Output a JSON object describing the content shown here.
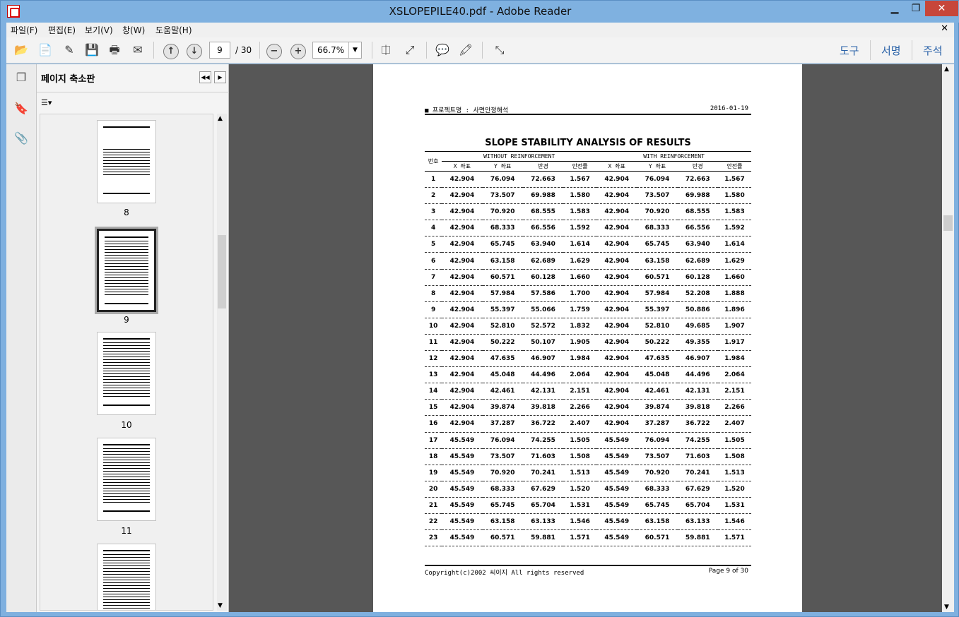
{
  "window": {
    "title": "XSLOPEPILE40.pdf - Adobe Reader",
    "min": "▁",
    "max": "❐",
    "close": "✕"
  },
  "menu": [
    "파일(F)",
    "편집(E)",
    "보기(V)",
    "창(W)",
    "도움말(H)"
  ],
  "menu_close": "✕",
  "toolbar": {
    "page_current": "9",
    "page_total": "/ 30",
    "zoom": "66.7%",
    "links": [
      "도구",
      "서명",
      "주석"
    ]
  },
  "panel": {
    "title": "페이지 축소판",
    "thumbs": [
      "8",
      "9",
      "10",
      "11"
    ]
  },
  "doc": {
    "header_left": "■ 프로젝트명 : 사면안정해석",
    "header_date": "2016-01-19",
    "title": "SLOPE STABILITY ANALYSIS OF RESULTS",
    "col_no": "번호",
    "group_without": "WITHOUT REINFORCEMENT",
    "group_with": "WITH REINFORCEMENT",
    "cols": [
      "X 좌표",
      "Y 좌표",
      "반경",
      "안전률",
      "X 좌표",
      "Y 좌표",
      "반경",
      "안전률"
    ],
    "rows": [
      [
        "1",
        "42.904",
        "76.094",
        "72.663",
        "1.567",
        "42.904",
        "76.094",
        "72.663",
        "1.567"
      ],
      [
        "2",
        "42.904",
        "73.507",
        "69.988",
        "1.580",
        "42.904",
        "73.507",
        "69.988",
        "1.580"
      ],
      [
        "3",
        "42.904",
        "70.920",
        "68.555",
        "1.583",
        "42.904",
        "70.920",
        "68.555",
        "1.583"
      ],
      [
        "4",
        "42.904",
        "68.333",
        "66.556",
        "1.592",
        "42.904",
        "68.333",
        "66.556",
        "1.592"
      ],
      [
        "5",
        "42.904",
        "65.745",
        "63.940",
        "1.614",
        "42.904",
        "65.745",
        "63.940",
        "1.614"
      ],
      [
        "6",
        "42.904",
        "63.158",
        "62.689",
        "1.629",
        "42.904",
        "63.158",
        "62.689",
        "1.629"
      ],
      [
        "7",
        "42.904",
        "60.571",
        "60.128",
        "1.660",
        "42.904",
        "60.571",
        "60.128",
        "1.660"
      ],
      [
        "8",
        "42.904",
        "57.984",
        "57.586",
        "1.700",
        "42.904",
        "57.984",
        "52.208",
        "1.888"
      ],
      [
        "9",
        "42.904",
        "55.397",
        "55.066",
        "1.759",
        "42.904",
        "55.397",
        "50.886",
        "1.896"
      ],
      [
        "10",
        "42.904",
        "52.810",
        "52.572",
        "1.832",
        "42.904",
        "52.810",
        "49.685",
        "1.907"
      ],
      [
        "11",
        "42.904",
        "50.222",
        "50.107",
        "1.905",
        "42.904",
        "50.222",
        "49.355",
        "1.917"
      ],
      [
        "12",
        "42.904",
        "47.635",
        "46.907",
        "1.984",
        "42.904",
        "47.635",
        "46.907",
        "1.984"
      ],
      [
        "13",
        "42.904",
        "45.048",
        "44.496",
        "2.064",
        "42.904",
        "45.048",
        "44.496",
        "2.064"
      ],
      [
        "14",
        "42.904",
        "42.461",
        "42.131",
        "2.151",
        "42.904",
        "42.461",
        "42.131",
        "2.151"
      ],
      [
        "15",
        "42.904",
        "39.874",
        "39.818",
        "2.266",
        "42.904",
        "39.874",
        "39.818",
        "2.266"
      ],
      [
        "16",
        "42.904",
        "37.287",
        "36.722",
        "2.407",
        "42.904",
        "37.287",
        "36.722",
        "2.407"
      ],
      [
        "17",
        "45.549",
        "76.094",
        "74.255",
        "1.505",
        "45.549",
        "76.094",
        "74.255",
        "1.505"
      ],
      [
        "18",
        "45.549",
        "73.507",
        "71.603",
        "1.508",
        "45.549",
        "73.507",
        "71.603",
        "1.508"
      ],
      [
        "19",
        "45.549",
        "70.920",
        "70.241",
        "1.513",
        "45.549",
        "70.920",
        "70.241",
        "1.513"
      ],
      [
        "20",
        "45.549",
        "68.333",
        "67.629",
        "1.520",
        "45.549",
        "68.333",
        "67.629",
        "1.520"
      ],
      [
        "21",
        "45.549",
        "65.745",
        "65.704",
        "1.531",
        "45.549",
        "65.745",
        "65.704",
        "1.531"
      ],
      [
        "22",
        "45.549",
        "63.158",
        "63.133",
        "1.546",
        "45.549",
        "63.158",
        "63.133",
        "1.546"
      ],
      [
        "23",
        "45.549",
        "60.571",
        "59.881",
        "1.571",
        "45.549",
        "60.571",
        "59.881",
        "1.571"
      ]
    ],
    "footer_left": "Copyright(c)2002 씨이지 All rights reserved",
    "footer_right": "Page 9 of 30"
  }
}
